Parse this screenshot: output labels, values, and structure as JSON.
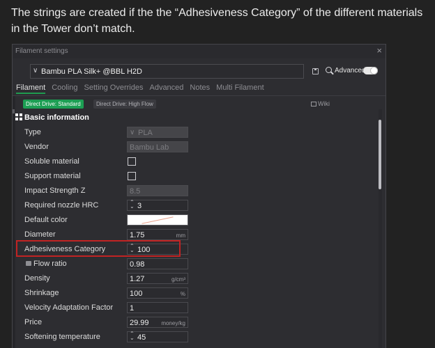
{
  "caption": "The strings are created if the the “Adhesiveness Category” of the different materials in the Tower don’t match.",
  "window": {
    "title": "Filament settings",
    "close_glyph": "×"
  },
  "preset": {
    "name": "Bambu PLA Silk+ @BBL H2D",
    "chevron": "∨"
  },
  "toolbar": {
    "save_icon": "save-icon",
    "search_icon": "search-icon",
    "advanced_label": "Advanced",
    "advanced_on": true
  },
  "tabs": [
    "Filament",
    "Cooling",
    "Setting Overrides",
    "Advanced",
    "Notes",
    "Multi Filament"
  ],
  "active_tab": "Filament",
  "drive_tabs": {
    "active": "Direct Drive: Standard",
    "inactive": "Direct Drive: High Flow"
  },
  "wiki_label": "Wiki",
  "section_title": "Basic information",
  "colors": {
    "accent": "#1c9e53",
    "highlight_box": "#c22323",
    "filament_color": "#ffffff"
  },
  "rows": {
    "type": {
      "label": "Type",
      "value": "PLA"
    },
    "vendor": {
      "label": "Vendor",
      "value": "Bambu Lab"
    },
    "soluble": {
      "label": "Soluble material",
      "checked": false
    },
    "support": {
      "label": "Support material",
      "checked": false
    },
    "impact": {
      "label": "Impact Strength Z",
      "value": "8.5"
    },
    "hrc": {
      "label": "Required nozzle HRC",
      "value": "3"
    },
    "color": {
      "label": "Default color"
    },
    "diameter": {
      "label": "Diameter",
      "value": "1.75",
      "unit": "mm"
    },
    "adhesiveness": {
      "label": "Adhesiveness Category",
      "value": "100"
    },
    "flow": {
      "label": "Flow ratio",
      "value": "0.98"
    },
    "density": {
      "label": "Density",
      "value": "1.27",
      "unit": "g/cm³"
    },
    "shrinkage": {
      "label": "Shrinkage",
      "value": "100",
      "unit": "%"
    },
    "velocity": {
      "label": "Velocity Adaptation Factor",
      "value": "1"
    },
    "price": {
      "label": "Price",
      "value": "29.99",
      "unit": "money/kg"
    },
    "softening": {
      "label": "Softening temperature",
      "value": "45"
    }
  }
}
